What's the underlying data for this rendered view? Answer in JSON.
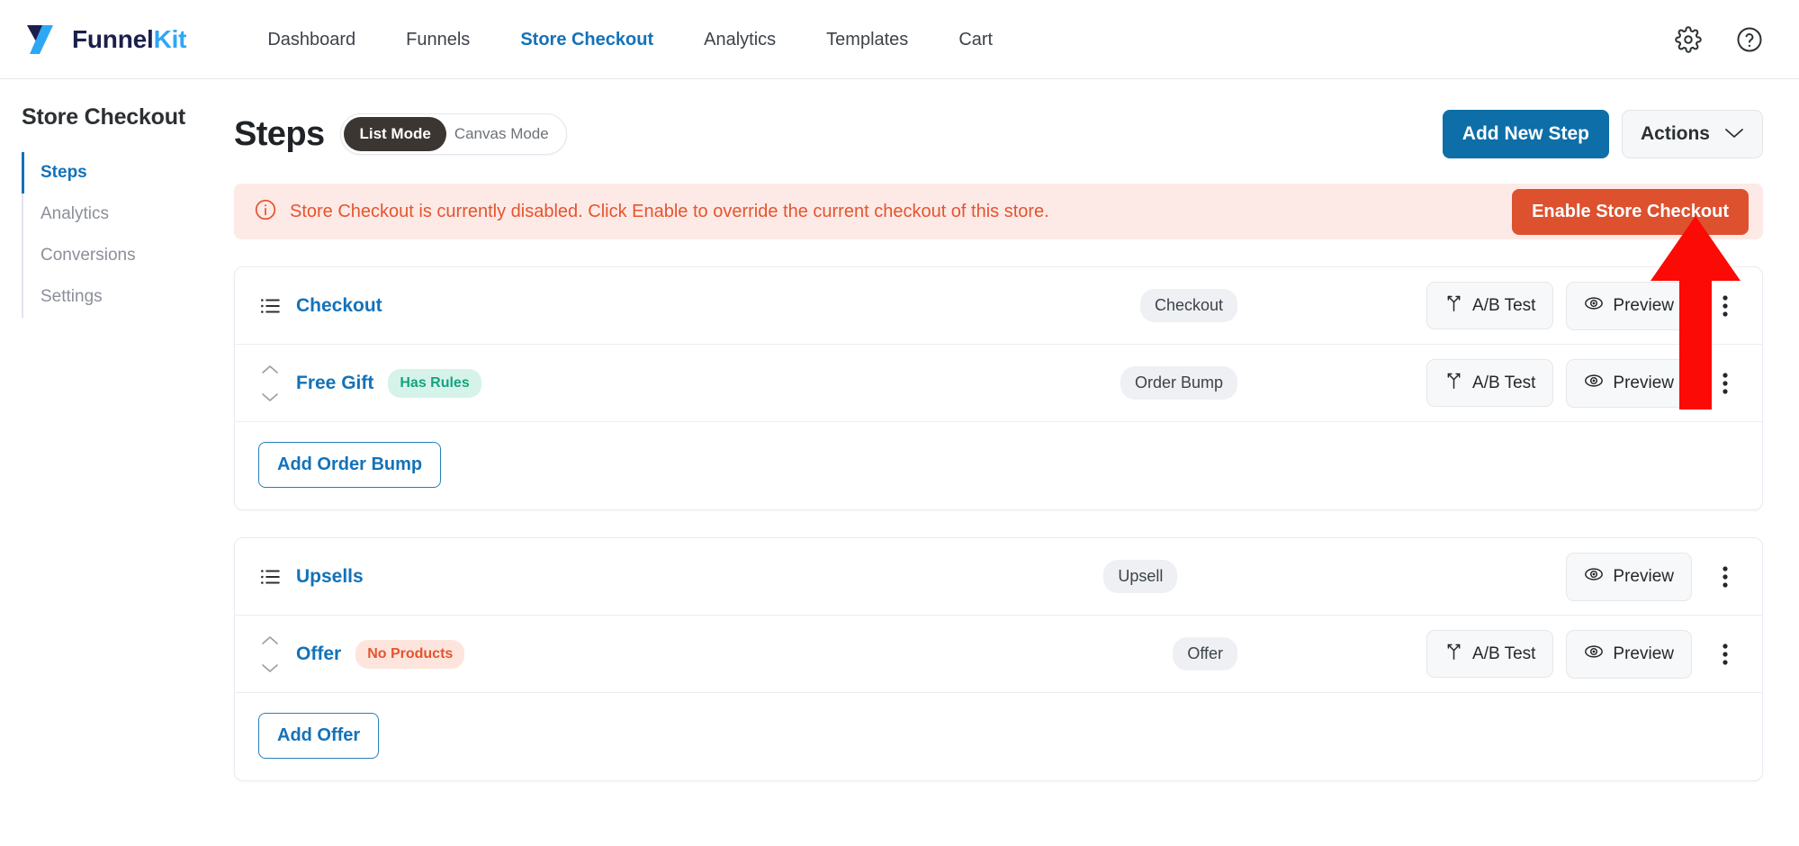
{
  "topbar": {
    "logo": {
      "name_primary": "Funnel",
      "name_accent": "Kit",
      "icon": "funnelkit-logo-icon"
    },
    "nav": [
      {
        "label": "Dashboard",
        "active": false
      },
      {
        "label": "Funnels",
        "active": false
      },
      {
        "label": "Store Checkout",
        "active": true
      },
      {
        "label": "Analytics",
        "active": false
      },
      {
        "label": "Templates",
        "active": false
      },
      {
        "label": "Cart",
        "active": false
      }
    ],
    "settings_icon": "gear-icon",
    "help_icon": "help-circle-icon"
  },
  "sidebar": {
    "title": "Store Checkout",
    "items": [
      {
        "label": "Steps",
        "active": true
      },
      {
        "label": "Analytics",
        "active": false
      },
      {
        "label": "Conversions",
        "active": false
      },
      {
        "label": "Settings",
        "active": false
      }
    ]
  },
  "main": {
    "title": "Steps",
    "mode_toggle": {
      "list_mode": "List Mode",
      "canvas_mode": "Canvas Mode",
      "selected": "List Mode"
    },
    "add_new_step": "Add New Step",
    "actions": "Actions",
    "notice": {
      "icon": "info-circle-icon",
      "text": "Store Checkout is currently disabled. Click Enable to override the current checkout of this store.",
      "button": "Enable Store Checkout"
    },
    "cards": [
      {
        "rows": [
          {
            "icon": "list-lines-icon",
            "name": "Checkout",
            "badge": null,
            "type": "Checkout",
            "buttons": [
              "A/B Test",
              "Preview"
            ],
            "menu": "kebab-menu-icon"
          },
          {
            "icon": "sort-arrows-icon",
            "name": "Free Gift",
            "badge": {
              "text": "Has Rules",
              "style": "green"
            },
            "type": "Order Bump",
            "buttons": [
              "A/B Test",
              "Preview"
            ],
            "menu": "kebab-menu-icon"
          }
        ],
        "footer_button": "Add Order Bump"
      },
      {
        "rows": [
          {
            "icon": "list-lines-icon",
            "name": "Upsells",
            "badge": null,
            "type": "Upsell",
            "buttons": [
              "Preview"
            ],
            "menu": "kebab-menu-icon"
          },
          {
            "icon": "sort-arrows-icon",
            "name": "Offer",
            "badge": {
              "text": "No Products",
              "style": "red"
            },
            "type": "Offer",
            "buttons": [
              "A/B Test",
              "Preview"
            ],
            "menu": "kebab-menu-icon"
          }
        ],
        "footer_button": "Add Offer"
      }
    ]
  },
  "annotation": {
    "type": "red-arrow",
    "points_to": "Enable Store Checkout",
    "color": "#fb0a06"
  },
  "colors": {
    "brand_dark": "#1b1f4b",
    "brand_accent": "#2ea7f5",
    "link_blue": "#1372b9",
    "primary_button": "#0d6ea8",
    "danger": "#dd512f",
    "notice_bg": "#fdeae6",
    "badge_green_bg": "#d6f3ea",
    "badge_green_text": "#15a37f",
    "badge_red_bg": "#fde5dd",
    "badge_red_text": "#e5542f"
  }
}
